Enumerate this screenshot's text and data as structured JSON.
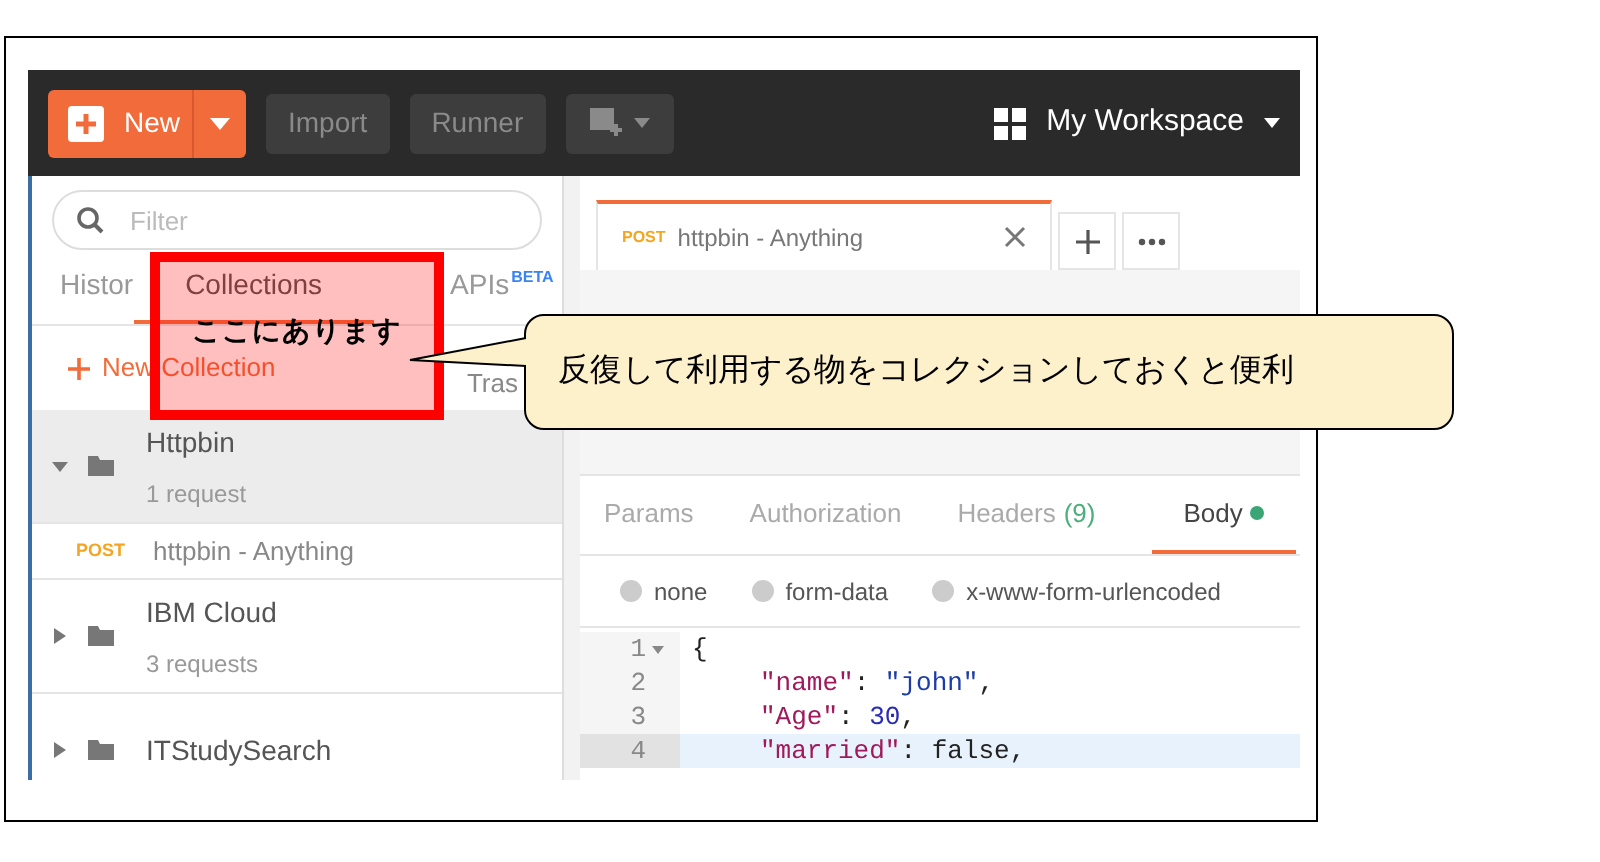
{
  "toolbar": {
    "new_button": "New",
    "buttons": [
      "Import",
      "Runner"
    ],
    "workspace": "My Workspace"
  },
  "sidebar": {
    "search": {
      "placeholder": "Filter"
    },
    "tabs": [
      {
        "label": "Histor",
        "selected": false
      },
      {
        "label": "Collections",
        "selected": true
      },
      {
        "label": "APIs",
        "badge": "BETA",
        "selected": false
      }
    ],
    "new_collection": "New Collection",
    "trash": "Tras",
    "collections": [
      {
        "name": "Httpbin",
        "count": "1 request",
        "expanded": true,
        "children": [
          {
            "method": "POST",
            "name": "httpbin - Anything"
          }
        ]
      },
      {
        "name": "IBM Cloud",
        "count": "3 requests",
        "expanded": false
      },
      {
        "name": "ITStudySearch",
        "expanded": false
      }
    ]
  },
  "request_tab": {
    "method": "POST",
    "title": "httpbin - Anything"
  },
  "request_subtabs": [
    {
      "label": "Params",
      "selected": false
    },
    {
      "label": "Authorization",
      "selected": false
    },
    {
      "label": "Headers",
      "count": "(9)",
      "selected": false
    },
    {
      "label": "Body",
      "dot": true,
      "selected": true
    }
  ],
  "body_modes": [
    {
      "label": "none",
      "selected": false
    },
    {
      "label": "form-data",
      "selected": false
    },
    {
      "label": "x-www-form-urlencoded",
      "selected": false
    }
  ],
  "code_lines": [
    {
      "number": "1",
      "foldable": true,
      "active": false,
      "tokens": [
        {
          "kind": "punct",
          "text": "{"
        }
      ]
    },
    {
      "number": "2",
      "foldable": false,
      "active": false,
      "tokens": [
        {
          "kind": "key",
          "text": "\"name\""
        },
        {
          "kind": "punct",
          "text": ": "
        },
        {
          "kind": "string",
          "text": "\"john\""
        },
        {
          "kind": "punct",
          "text": ","
        }
      ]
    },
    {
      "number": "3",
      "foldable": false,
      "active": false,
      "tokens": [
        {
          "kind": "key",
          "text": "\"Age\""
        },
        {
          "kind": "punct",
          "text": ": "
        },
        {
          "kind": "number",
          "text": "30"
        },
        {
          "kind": "punct",
          "text": ","
        }
      ]
    },
    {
      "number": "4",
      "foldable": false,
      "active": true,
      "tokens": [
        {
          "kind": "key",
          "text": "\"married\""
        },
        {
          "kind": "punct",
          "text": ": false,"
        }
      ]
    }
  ],
  "annotation": {
    "highlight_label": "ここにあります",
    "callout": "反復して利用する物をコレクションしておくと便利"
  }
}
